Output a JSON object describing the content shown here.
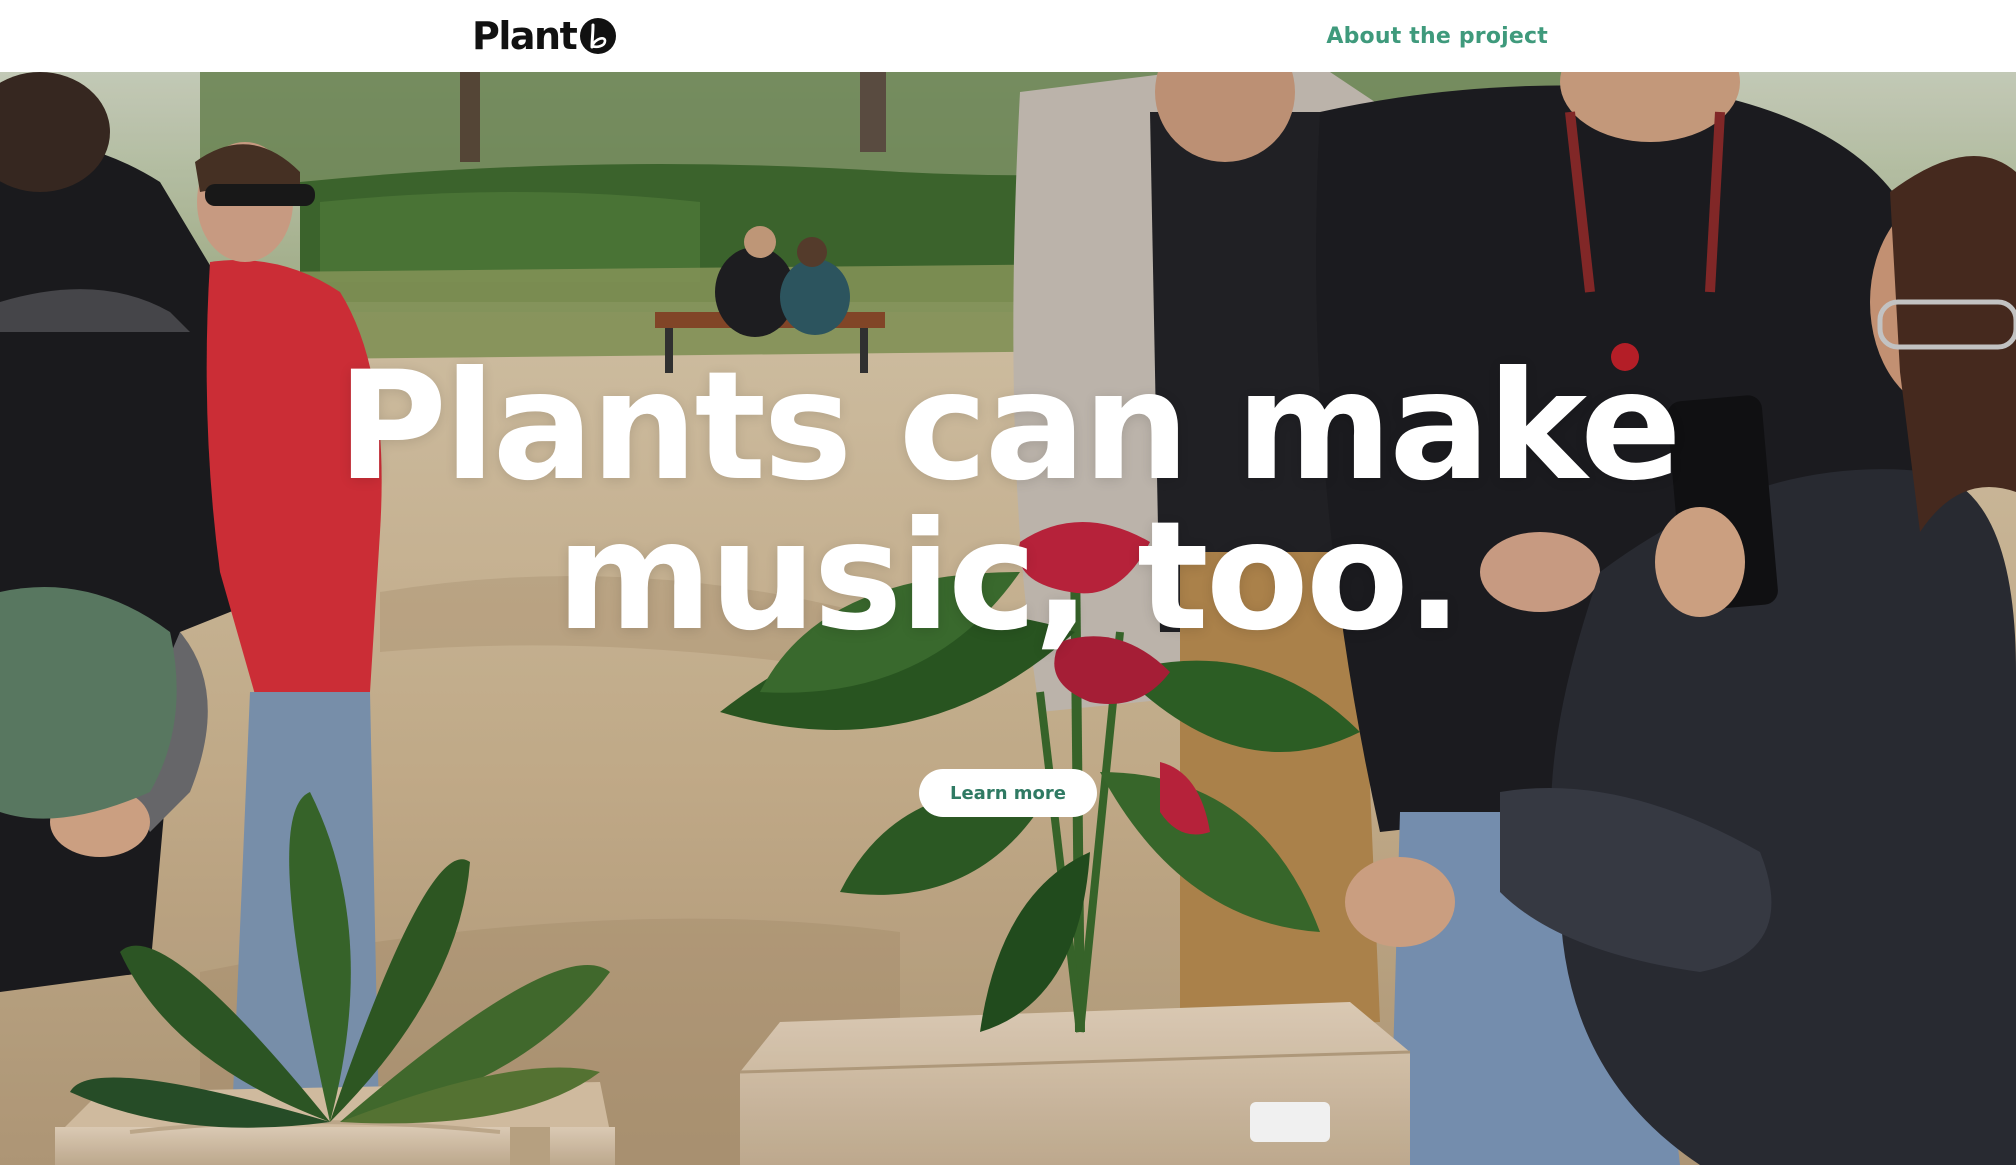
{
  "header": {
    "logo_text": "Plant",
    "logo_mark_icon": "leaf-b-circle-icon",
    "nav": {
      "about_label": "About the project"
    }
  },
  "hero": {
    "title_line1": "Plants can make",
    "title_line2": "music, too.",
    "cta_label": "Learn more",
    "background": "photo-people-with-plants-in-park"
  },
  "colors": {
    "accent": "#3f9a7c",
    "cta_text": "#2f7a63",
    "header_bg": "#ffffff",
    "title_text": "#ffffff"
  }
}
